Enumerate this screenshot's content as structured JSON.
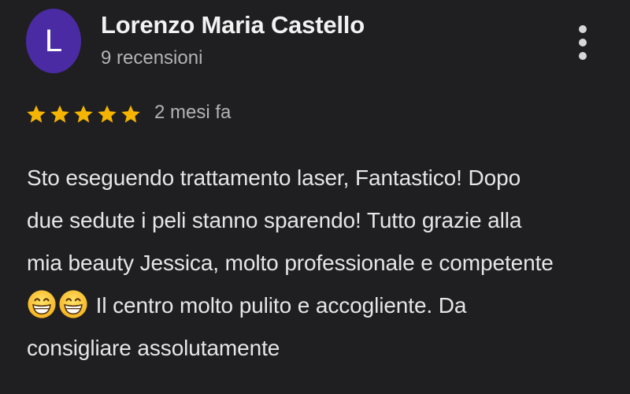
{
  "review": {
    "author": {
      "initial": "L",
      "name": "Lorenzo Maria Castello",
      "review_count": "9 recensioni",
      "avatar_color": "#4b2ba3"
    },
    "menu_icon": "more-vertical-icon",
    "rating": 5,
    "rating_max": 5,
    "star_color": "#f4b400",
    "star_icon": "star-icon",
    "date": "2 mesi fa",
    "text_lines": [
      "Sto eseguendo trattamento laser, Fantastico! Dopo",
      "due sedute i peli stanno sparendo! Tutto grazie alla",
      "mia beauty Jessica, molto professionale e competente",
      " Il centro molto pulito e accogliente. Da",
      "consigliare assolutamente"
    ],
    "emoji_icon": "grinning-face-emoji-icon"
  }
}
